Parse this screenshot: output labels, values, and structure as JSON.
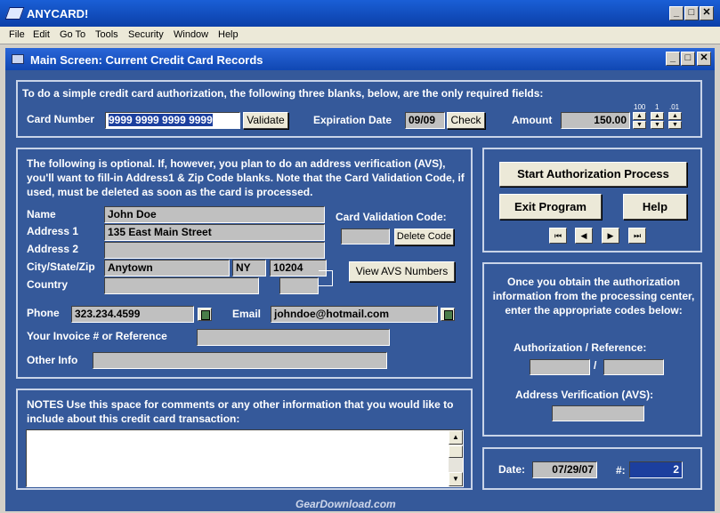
{
  "app": {
    "title": "ANYCARD!"
  },
  "menu": [
    "File",
    "Edit",
    "Go To",
    "Tools",
    "Security",
    "Window",
    "Help"
  ],
  "window": {
    "title": "Main Screen: Current Credit Card Records"
  },
  "required": {
    "instructions": "To do a simple credit card authorization, the following three blanks, below, are the only required fields:",
    "card_label": "Card Number",
    "card_value": "9999 9999 9999 9999",
    "validate_label": "Validate",
    "exp_label": "Expiration Date",
    "exp_value": "09/09",
    "check_label": "Check",
    "amount_label": "Amount",
    "amount_value": "150.00",
    "spin_labels": [
      "100",
      "1",
      ".01"
    ]
  },
  "optional": {
    "instructions": "The following is optional.  If, however, you plan to do an address verification (AVS), you'll want to fill-in Address1 & Zip Code blanks.  Note that the Card Validation Code, if used, must be deleted as soon as the card is processed.",
    "name_label": "Name",
    "name_value": "John Doe",
    "address1_label": "Address 1",
    "address1_value": "135 East Main Street",
    "address2_label": "Address 2",
    "address2_value": "",
    "csz_label": "City/State/Zip",
    "city_value": "Anytown",
    "state_value": "NY",
    "zip_value": "10204",
    "country_label": "Country",
    "country_value": "",
    "cvc_label": "Card Validation Code:",
    "cvc_value": "",
    "delete_code_label": "Delete Code",
    "view_avs_label": "View AVS Numbers",
    "phone_label": "Phone",
    "phone_value": "323.234.4599",
    "email_label": "Email",
    "email_value": "johndoe@hotmail.com",
    "invoice_label": "Your Invoice # or Reference",
    "invoice_value": "",
    "other_label": "Other Info",
    "other_value": ""
  },
  "actions": {
    "start_label": "Start Authorization Process",
    "exit_label": "Exit  Program",
    "help_label": "Help"
  },
  "auth": {
    "instructions": "Once you obtain the authorization information from the processing center, enter the appropriate codes below:",
    "auth_label": "Authorization / Reference:",
    "slash": "/",
    "auth_value": "",
    "ref_value": "",
    "avs_label": "Address Verification (AVS):",
    "avs_value": ""
  },
  "notes": {
    "label": "NOTES  Use this space for comments or any other information that you would like to include about this credit card transaction:",
    "value": ""
  },
  "footer": {
    "date_label": "Date:",
    "date_value": "07/29/07",
    "num_label": "#:",
    "num_value": "2"
  },
  "watermark": "GearDownload.com"
}
